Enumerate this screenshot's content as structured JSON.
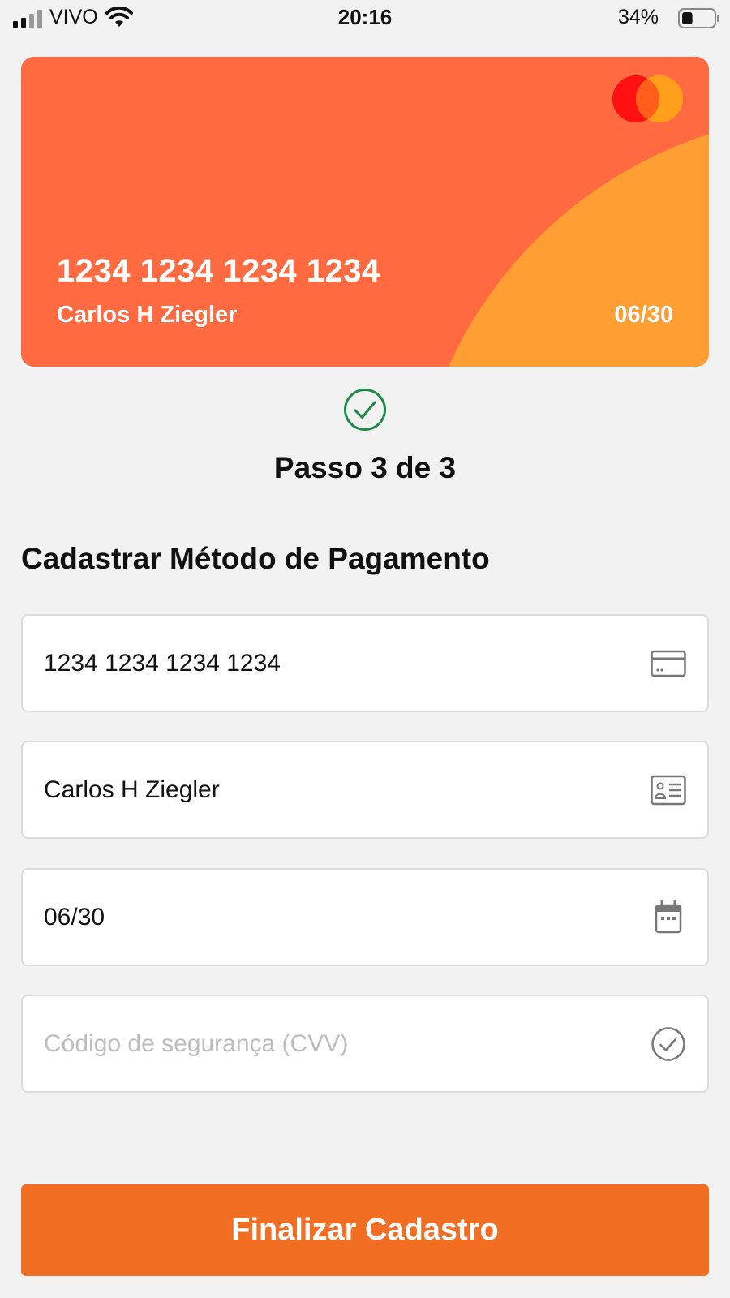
{
  "status_bar": {
    "carrier": "VIVO",
    "time": "20:16",
    "battery_percent": "34%",
    "battery_level": 0.34
  },
  "card_preview": {
    "number": "1234 1234 1234 1234",
    "holder": "Carlos H Ziegler",
    "expiry": "06/30",
    "brand_icon": "mastercard-logo",
    "colors": {
      "base": "#ff6a40",
      "accent": "#ff9f33"
    }
  },
  "step": {
    "label": "Passo 3 de 3",
    "icon": "check-circle-icon",
    "color": "#1e8a4a"
  },
  "form": {
    "title": "Cadastrar Método de Pagamento",
    "card_number": {
      "value": "1234 1234 1234 1234",
      "placeholder": "",
      "icon": "credit-card-icon"
    },
    "holder_name": {
      "value": "Carlos H Ziegler",
      "placeholder": "",
      "icon": "id-card-icon"
    },
    "expiry": {
      "value": "06/30",
      "placeholder": "",
      "icon": "calendar-icon"
    },
    "cvv": {
      "value": "",
      "placeholder": "Código de segurança (CVV)",
      "icon": "check-circle-icon"
    }
  },
  "submit": {
    "label": "Finalizar Cadastro",
    "color": "#f26e22"
  }
}
